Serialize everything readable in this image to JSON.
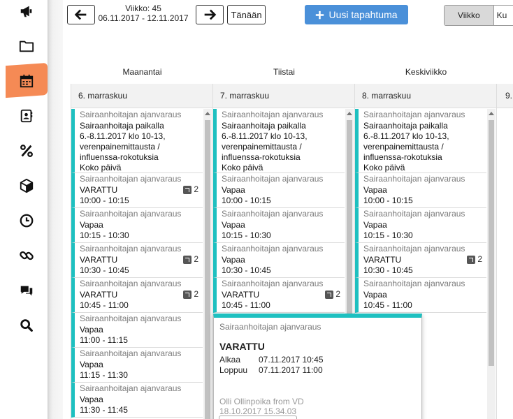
{
  "header": {
    "week": "Viikko: 45",
    "range": "06.11.2017 - 12.11.2017",
    "today": "Tänään",
    "new_event": "Uusi tapahtuma",
    "views": [
      "Viikko",
      "Ku"
    ]
  },
  "day_names": [
    "Maanantai",
    "Tiistai",
    "Keskiviikko"
  ],
  "columns": [
    {
      "date": "6. marraskuu",
      "events": [
        {
          "service": "Sairaanhoitajan ajanvaraus",
          "status": "Sairaanhoitaja paikalla 6.-8.11.2017 klo 10-13, verenpainemittausta / influenssa-rokotuksia",
          "time": "Koko päivä",
          "count": ""
        },
        {
          "service": "Sairaanhoitajan ajanvaraus",
          "status": "VARATTU",
          "time": "10:00 - 10:15",
          "count": "2"
        },
        {
          "service": "Sairaanhoitajan ajanvaraus",
          "status": "Vapaa",
          "time": "10:15 - 10:30",
          "count": ""
        },
        {
          "service": "Sairaanhoitajan ajanvaraus",
          "status": "VARATTU",
          "time": "10:30 - 10:45",
          "count": "2"
        },
        {
          "service": "Sairaanhoitajan ajanvaraus",
          "status": "VARATTU",
          "time": "10:45 - 11:00",
          "count": "2"
        },
        {
          "service": "Sairaanhoitajan ajanvaraus",
          "status": "Vapaa",
          "time": "11:00 - 11:15",
          "count": ""
        },
        {
          "service": "Sairaanhoitajan ajanvaraus",
          "status": "Vapaa",
          "time": "11:15 - 11:30",
          "count": ""
        },
        {
          "service": "Sairaanhoitajan ajanvaraus",
          "status": "Vapaa",
          "time": "11:30 - 11:45",
          "count": ""
        }
      ]
    },
    {
      "date": "7. marraskuu",
      "events": [
        {
          "service": "Sairaanhoitajan ajanvaraus",
          "status": "Sairaanhoitaja paikalla 6.-8.11.2017 klo 10-13, verenpainemittausta / influenssa-rokotuksia",
          "time": "Koko päivä",
          "count": ""
        },
        {
          "service": "Sairaanhoitajan ajanvaraus",
          "status": "Vapaa",
          "time": "10:00 - 10:15",
          "count": ""
        },
        {
          "service": "Sairaanhoitajan ajanvaraus",
          "status": "Vapaa",
          "time": "10:15 - 10:30",
          "count": ""
        },
        {
          "service": "Sairaanhoitajan ajanvaraus",
          "status": "Vapaa",
          "time": "10:30 - 10:45",
          "count": ""
        },
        {
          "service": "Sairaanhoitajan ajanvaraus",
          "status": "VARATTU",
          "time": "10:45 - 11:00",
          "count": "2"
        }
      ]
    },
    {
      "date": "8. marraskuu",
      "events": [
        {
          "service": "Sairaanhoitajan ajanvaraus",
          "status": "Sairaanhoitaja paikalla 6.-8.11.2017 klo 10-13, verenpainemittausta / influenssa-rokotuksia",
          "time": "Koko päivä",
          "count": ""
        },
        {
          "service": "Sairaanhoitajan ajanvaraus",
          "status": "Vapaa",
          "time": "10:00 - 10:15",
          "count": ""
        },
        {
          "service": "Sairaanhoitajan ajanvaraus",
          "status": "Vapaa",
          "time": "10:15 - 10:30",
          "count": ""
        },
        {
          "service": "Sairaanhoitajan ajanvaraus",
          "status": "VARATTU",
          "time": "10:30 - 10:45",
          "count": "2"
        },
        {
          "service": "Sairaanhoitajan ajanvaraus",
          "status": "Vapaa",
          "time": "10:45 - 11:00",
          "count": ""
        }
      ]
    },
    {
      "date": "9.",
      "events": []
    }
  ],
  "popup": {
    "service": "Sairaanhoitajan ajanvaraus",
    "title": "VARATTU",
    "start_label": "Alkaa",
    "start": "07.11.2017 10:45",
    "end_label": "Loppuu",
    "end": "07.11.2017 11:00",
    "author": "Olli Ollinpoika from VD",
    "created": "18.10.2017 15.34.03"
  },
  "colors": {
    "accent": "#1ec0c0",
    "primary": "#4a90d9",
    "active_nav": "#f58a55"
  },
  "nav_icons": [
    "megaphone-icon",
    "folder-icon",
    "calendar-icon",
    "contacts-icon",
    "percent-icon",
    "box-icon",
    "clock-icon",
    "link-icon",
    "chat-icon",
    "search-icon"
  ]
}
